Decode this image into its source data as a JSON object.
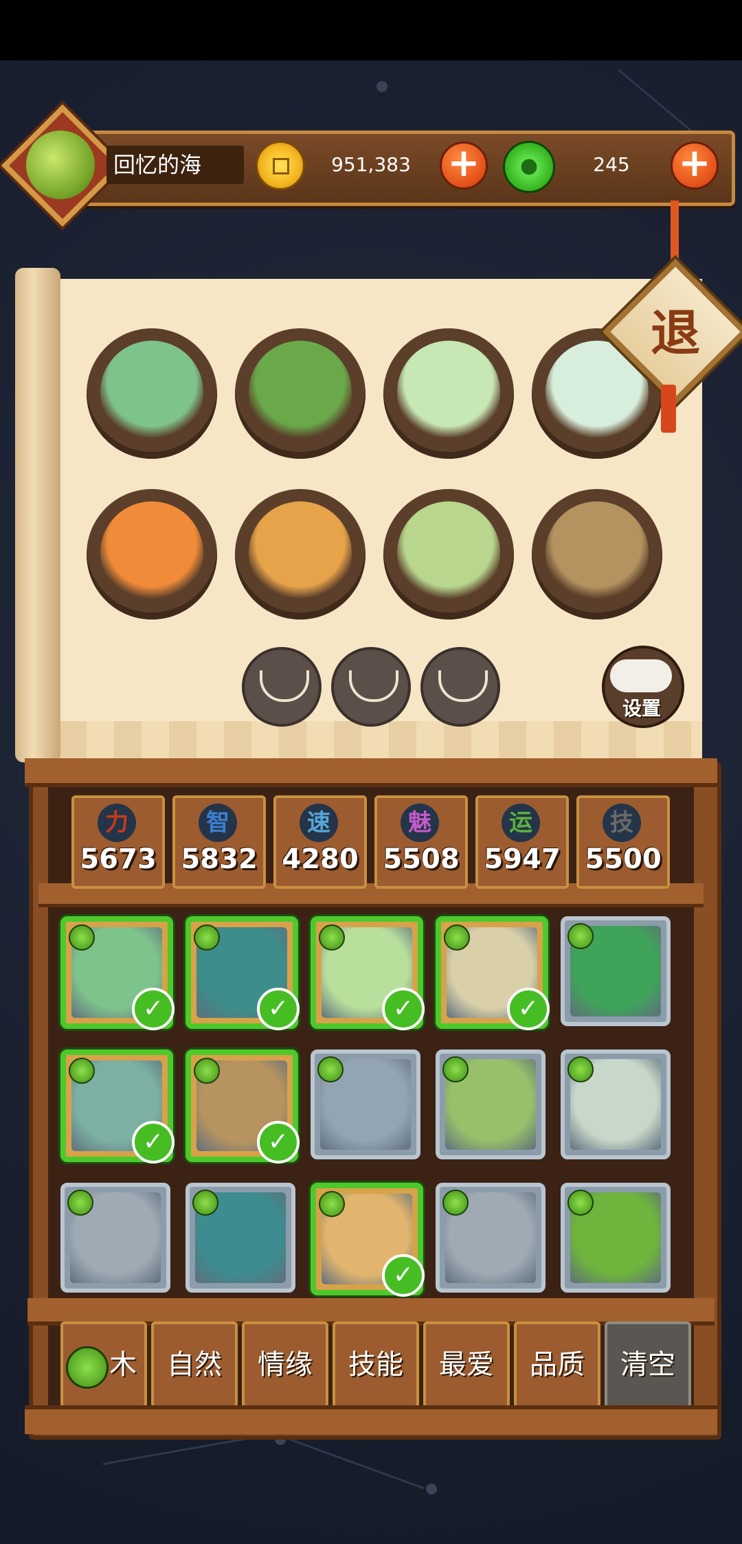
{
  "player": {
    "name": "回忆的海",
    "avatar_icon": "green-dragon-avatar-icon"
  },
  "resources": {
    "coins": {
      "value": "951,383",
      "icon": "gold-coin-icon"
    },
    "jade": {
      "value": "245",
      "icon": "jade-disc-icon"
    },
    "add_label": "+"
  },
  "exit": {
    "label": "退"
  },
  "settings": {
    "label": "设置",
    "icon": "gamepad-icon"
  },
  "team_slots": [
    {
      "name": "monkey-warrior",
      "color": "#7fc38c"
    },
    {
      "name": "bearded-sage",
      "color": "#6aa94a"
    },
    {
      "name": "jade-turtle-hero",
      "color": "#c7e7b5"
    },
    {
      "name": "flower-maiden",
      "color": "#d8eedd"
    },
    {
      "name": "coin-hat-girl",
      "color": "#f08b3a"
    },
    {
      "name": "leaf-dancer",
      "color": "#e7a34a"
    },
    {
      "name": "silver-hair-swordsman",
      "color": "#b8d68e"
    },
    {
      "name": "straw-hat-archer",
      "color": "#b59360"
    }
  ],
  "empty_slots": [
    {
      "icon": "rice-bowl-icon"
    },
    {
      "icon": "rice-bowl-icon"
    },
    {
      "icon": "rice-bowl-icon"
    }
  ],
  "stats": [
    {
      "icon_label": "力",
      "value": "5673",
      "color": "#c63a1a"
    },
    {
      "icon_label": "智",
      "value": "5832",
      "color": "#3c7fd0"
    },
    {
      "icon_label": "速",
      "value": "4280",
      "color": "#55a6d8"
    },
    {
      "icon_label": "魅",
      "value": "5508",
      "color": "#c55ac9"
    },
    {
      "icon_label": "运",
      "value": "5947",
      "color": "#5bb23a"
    },
    {
      "icon_label": "技",
      "value": "5500",
      "color": "#6a6a6a"
    }
  ],
  "heroes": [
    {
      "name": "monkey-warrior",
      "selected": true,
      "color": "#7fc38c"
    },
    {
      "name": "bearded-sage",
      "selected": true,
      "color": "#3d8e8a"
    },
    {
      "name": "jade-turtle-hero",
      "selected": true,
      "color": "#b9df9d"
    },
    {
      "name": "flower-maiden",
      "selected": true,
      "color": "#d9cfa9"
    },
    {
      "name": "tiger-mage",
      "selected": false,
      "color": "#3fa45a"
    },
    {
      "name": "coin-hat-girl",
      "selected": true,
      "color": "#7cb0a3"
    },
    {
      "name": "straw-hat-archer",
      "selected": true,
      "color": "#b7945f"
    },
    {
      "name": "wolf-scholar",
      "selected": false,
      "color": "#93a5b3"
    },
    {
      "name": "green-hair-boy",
      "selected": false,
      "color": "#98c06a"
    },
    {
      "name": "twin-fairies",
      "selected": false,
      "color": "#c7d7c9"
    },
    {
      "name": "sprout-creature",
      "selected": false,
      "color": "#9faab4"
    },
    {
      "name": "witch-girl",
      "selected": false,
      "color": "#3d8c8f"
    },
    {
      "name": "leaf-dancer",
      "selected": true,
      "color": "#e2b56f"
    },
    {
      "name": "lotus-flower",
      "selected": false,
      "color": "#9faab4"
    },
    {
      "name": "tree-man",
      "selected": false,
      "color": "#6fb43d"
    }
  ],
  "filters": [
    {
      "label": "木",
      "icon": "leaf-icon"
    },
    {
      "label": "自然"
    },
    {
      "label": "情缘"
    },
    {
      "label": "技能"
    },
    {
      "label": "最爱"
    },
    {
      "label": "品质"
    },
    {
      "label": "清空"
    }
  ],
  "check_mark": "✓"
}
